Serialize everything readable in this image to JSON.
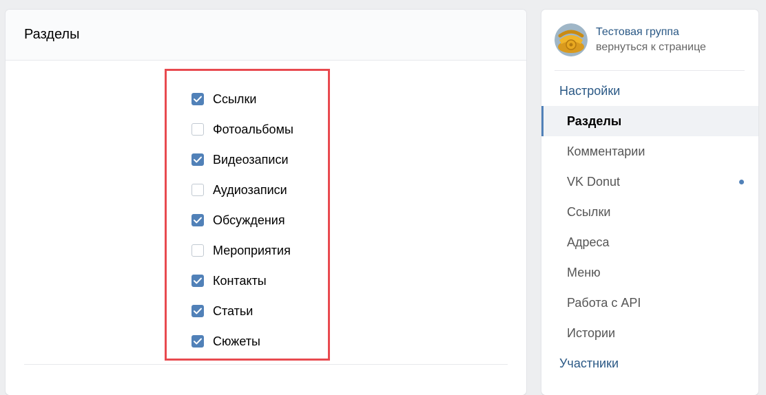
{
  "main": {
    "title": "Разделы",
    "options": [
      {
        "label": "Ссылки",
        "checked": true
      },
      {
        "label": "Фотоальбомы",
        "checked": false
      },
      {
        "label": "Видеозаписи",
        "checked": true
      },
      {
        "label": "Аудиозаписи",
        "checked": false
      },
      {
        "label": "Обсуждения",
        "checked": true
      },
      {
        "label": "Мероприятия",
        "checked": false
      },
      {
        "label": "Контакты",
        "checked": true
      },
      {
        "label": "Статьи",
        "checked": true
      },
      {
        "label": "Сюжеты",
        "checked": true
      }
    ]
  },
  "sidebar": {
    "group_name": "Тестовая группа",
    "back_link": "вернуться к странице",
    "section_settings": "Настройки",
    "items": [
      {
        "label": "Разделы",
        "active": true
      },
      {
        "label": "Комментарии",
        "active": false
      },
      {
        "label": "VK Donut",
        "active": false,
        "dot": true
      },
      {
        "label": "Ссылки",
        "active": false
      },
      {
        "label": "Адреса",
        "active": false
      },
      {
        "label": "Меню",
        "active": false
      },
      {
        "label": "Работа с API",
        "active": false
      },
      {
        "label": "Истории",
        "active": false
      }
    ],
    "section_members": "Участники"
  },
  "colors": {
    "accent": "#5181b8",
    "highlight": "#e84a4f",
    "link": "#2a5885"
  },
  "icons": {
    "avatar": "telephone-avatar",
    "checkmark": "check-icon"
  }
}
